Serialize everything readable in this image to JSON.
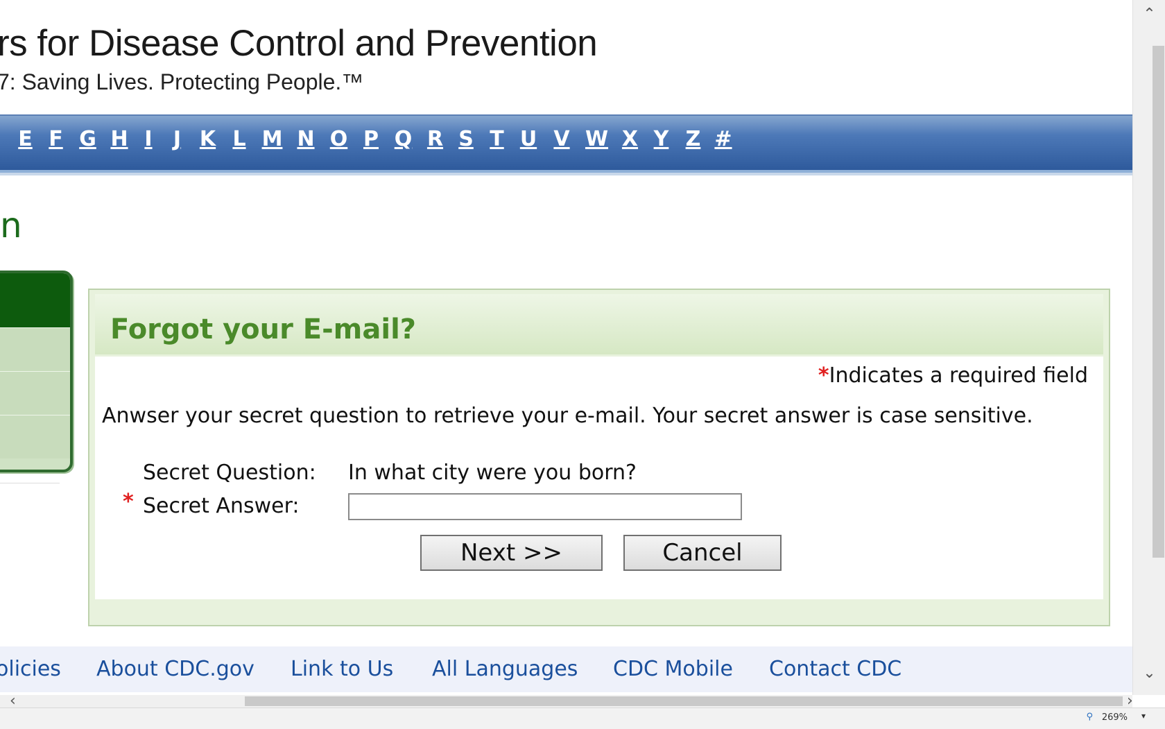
{
  "header": {
    "title": "rs for Disease Control and Prevention",
    "tagline": "7: Saving Lives. Protecting People.™"
  },
  "az_nav": {
    "letters": [
      "E",
      "F",
      "G",
      "H",
      "I",
      "J",
      "K",
      "L",
      "M",
      "N",
      "O",
      "P",
      "Q",
      "R",
      "S",
      "T",
      "U",
      "V",
      "W",
      "X",
      "Y",
      "Z",
      "#"
    ]
  },
  "page_heading": "n",
  "panel": {
    "title": "Forgot your E-mail?",
    "required_star": "*",
    "required_note": "Indicates a required field",
    "instructions": "Anwser your secret question to retrieve your e-mail. Your secret answer is case sensitive.",
    "question_label": "Secret Question:",
    "question_value": "In what city were you born?",
    "answer_label": "Secret Answer:",
    "answer_value": "",
    "next_label": "Next >>",
    "cancel_label": "Cancel"
  },
  "footer": {
    "links": [
      "olicies",
      "About CDC.gov",
      "Link to Us",
      "All Languages",
      "CDC Mobile",
      "Contact CDC"
    ]
  },
  "statusbar": {
    "zoom": "269%"
  },
  "colors": {
    "az_bar": "#3f6aac",
    "panel_title": "#4a8a2a",
    "required_star": "#e02020",
    "footer_link": "#1a4f9c"
  }
}
